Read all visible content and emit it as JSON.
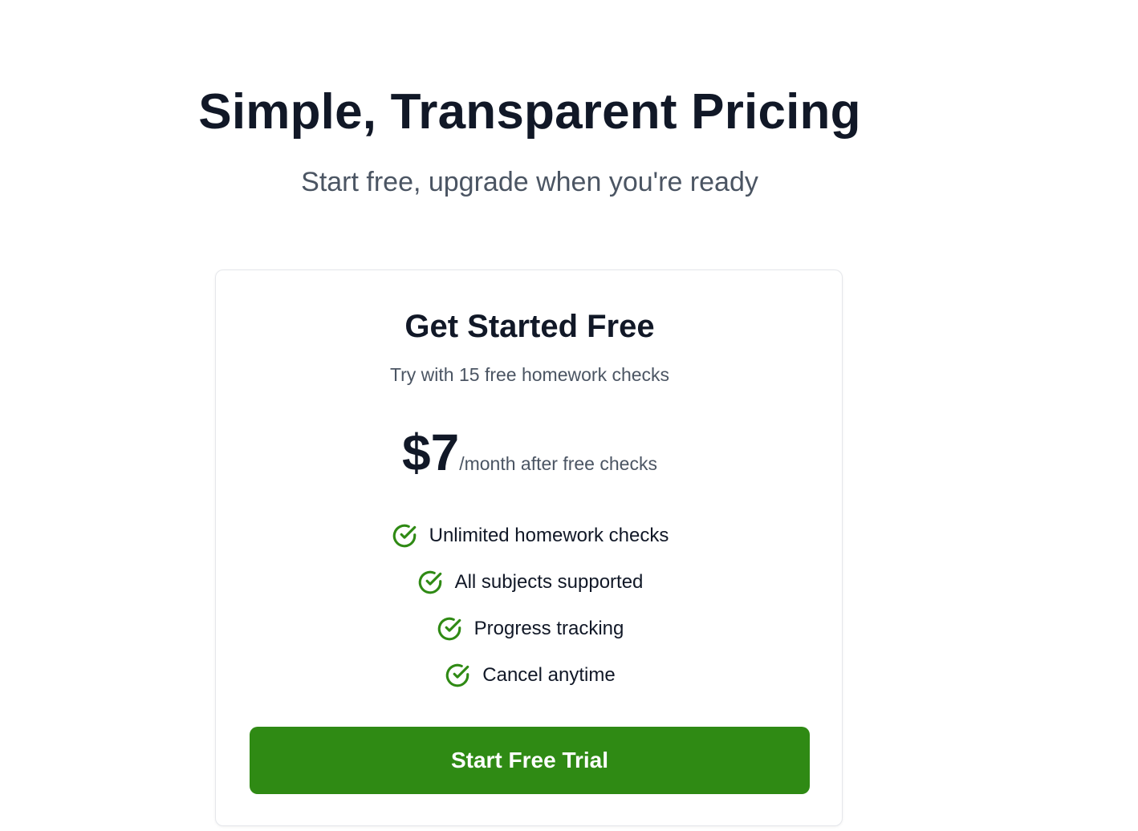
{
  "hero": {
    "title": "Simple, Transparent Pricing",
    "subtitle": "Start free, upgrade when you're ready"
  },
  "plan": {
    "name": "Get Started Free",
    "tagline": "Try with 15 free homework checks",
    "price": "$7",
    "period": "/month after free checks",
    "features": [
      {
        "label": "Unlimited homework checks",
        "icon": "check-circle-icon"
      },
      {
        "label": "All subjects supported",
        "icon": "check-circle-icon"
      },
      {
        "label": "Progress tracking",
        "icon": "check-circle-icon"
      },
      {
        "label": "Cancel anytime",
        "icon": "check-circle-icon"
      }
    ],
    "cta_label": "Start Free Trial"
  },
  "colors": {
    "accent": "#2f8a14",
    "heading": "#111827",
    "muted": "#4b5563"
  }
}
